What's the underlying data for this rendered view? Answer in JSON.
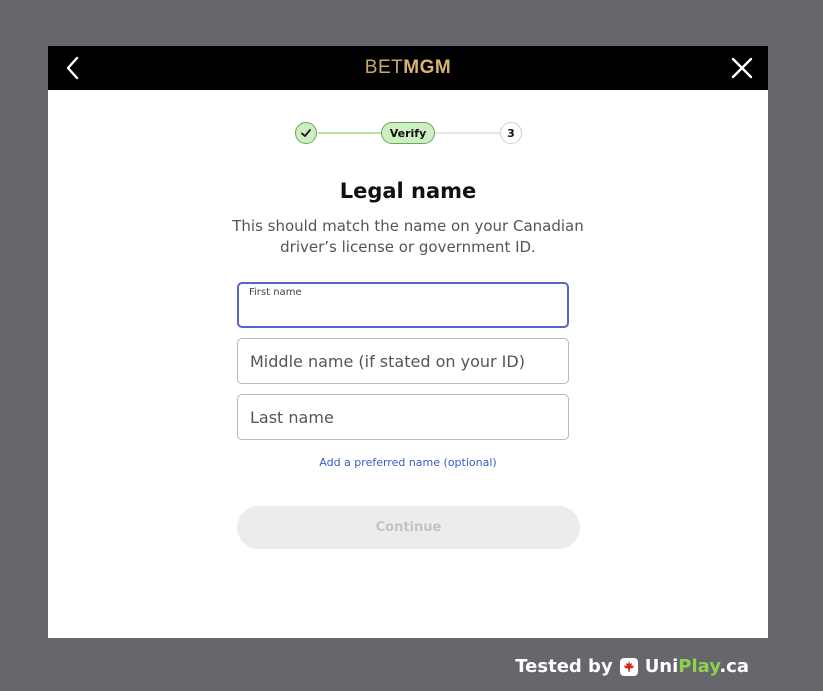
{
  "header": {
    "logo_bet": "BET",
    "logo_mgm": "MGM"
  },
  "stepper": {
    "current_label": "Verify",
    "next_label": "3"
  },
  "form": {
    "title": "Legal name",
    "subtitle": "This should match the name on your Canadian driver’s license or government ID.",
    "first_name_label": "First name",
    "first_name_value": "",
    "middle_name_placeholder": "Middle name (if stated on your ID)",
    "last_name_placeholder": "Last name",
    "preferred_link": "Add a preferred name (optional)",
    "continue_label": "Continue"
  },
  "footer": {
    "tested_by": "Tested by",
    "brand_uni": "Uni",
    "brand_play": "Play",
    "brand_tld": ".ca"
  },
  "colors": {
    "page_bg": "#65676b",
    "topbar": "#000000",
    "logo_gold": "#d8b56e",
    "step_green": "#cdeec0",
    "focus_blue": "#5566c7",
    "link_blue": "#3b5bc7"
  },
  "icons": {
    "back": "chevron-left-icon",
    "close": "close-icon",
    "step_done": "checkmark-icon",
    "flag": "maple-leaf-icon"
  }
}
